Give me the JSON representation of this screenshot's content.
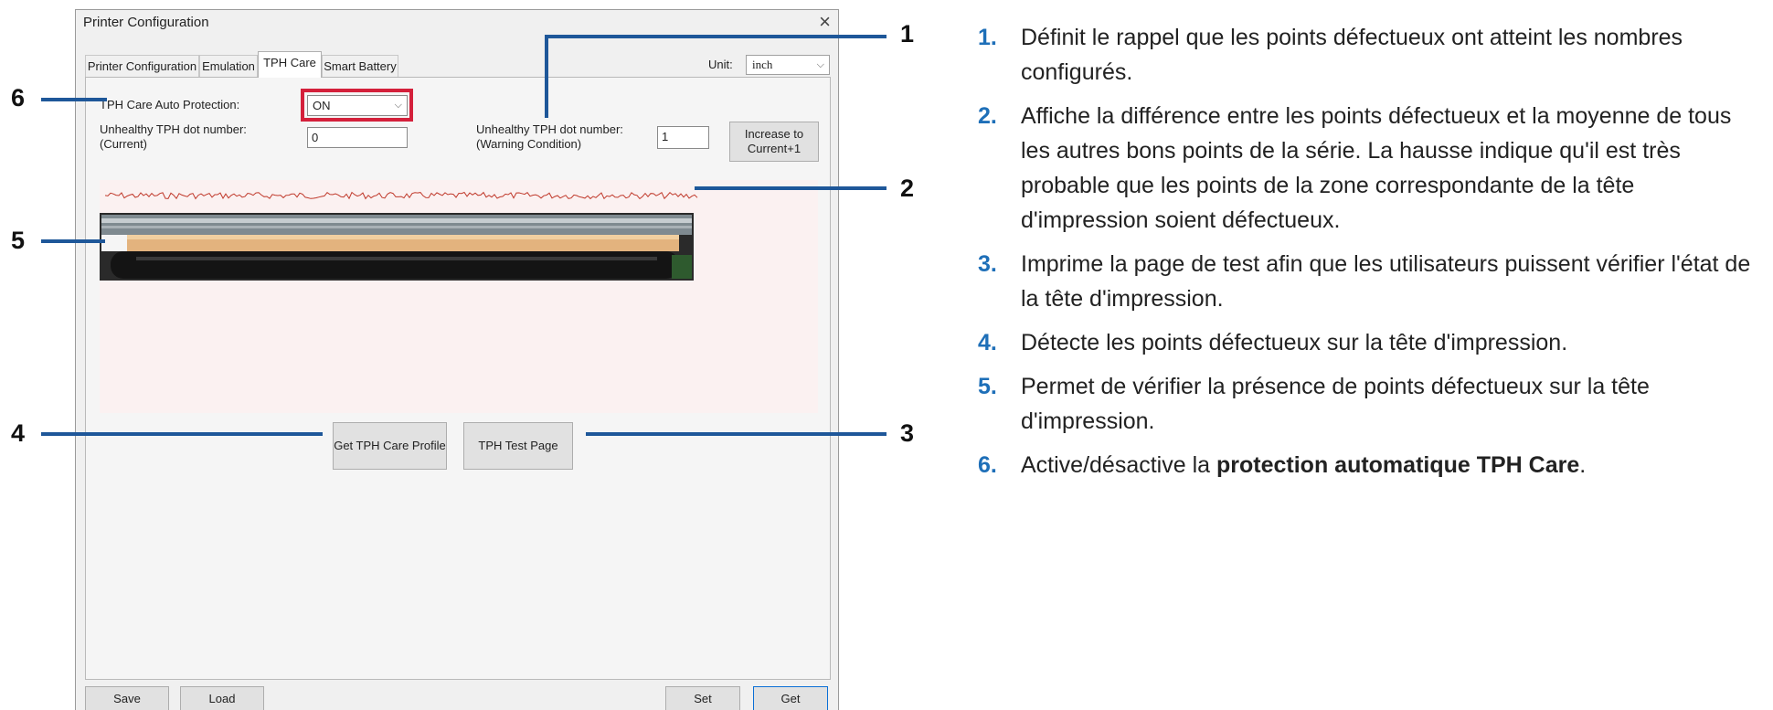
{
  "window": {
    "title": "Printer Configuration",
    "close_glyph": "×"
  },
  "tabs": [
    {
      "label": "Printer Configuration",
      "active": false
    },
    {
      "label": "Emulation",
      "active": false
    },
    {
      "label": "TPH Care",
      "active": true
    },
    {
      "label": "Smart Battery",
      "active": false
    }
  ],
  "unit": {
    "label": "Unit:",
    "value": "inch"
  },
  "tph": {
    "protection_label": "TPH Care Auto Protection:",
    "protection_value": "ON",
    "current_label_1": "Unhealthy TPH dot number:",
    "current_label_2": "(Current)",
    "current_value": "0",
    "warning_label_1": "Unhealthy TPH dot number:",
    "warning_label_2": "(Warning Condition)",
    "warning_value": "1",
    "increase_label_1": "Increase to",
    "increase_label_2": "Current+1",
    "get_profile_label": "Get TPH Care Profile",
    "test_page_label": "TPH Test Page"
  },
  "footer": {
    "save": "Save",
    "load": "Load",
    "set": "Set",
    "get": "Get"
  },
  "callouts": [
    "1",
    "2",
    "3",
    "4",
    "5",
    "6"
  ],
  "descriptions": [
    {
      "num": "1.",
      "text": "Définit le rappel que les points défectueux ont atteint les nombres configurés."
    },
    {
      "num": "2.",
      "text": "Affiche la différence entre les points défectueux et la moyenne de tous les autres bons points de la série. La hausse indique qu'il est très probable que les points de la zone correspondante de la tête d'impression soient défectueux."
    },
    {
      "num": "3.",
      "text": "Imprime la page de test afin que les utilisateurs puissent vérifier l'état de la tête d'impression."
    },
    {
      "num": "4.",
      "text": "Détecte les points défectueux sur la tête d'impression."
    },
    {
      "num": "5.",
      "text": "Permet de vérifier la présence de points défectueux sur la tête d'impression."
    },
    {
      "num": "6.",
      "text_before": "Active/désactive la ",
      "text_bold": "protection automatique TPH Care",
      "text_after": "."
    }
  ],
  "colors": {
    "accent": "#1e5799",
    "number_blue": "#1e6fb8",
    "highlight_red": "#d4203b"
  }
}
